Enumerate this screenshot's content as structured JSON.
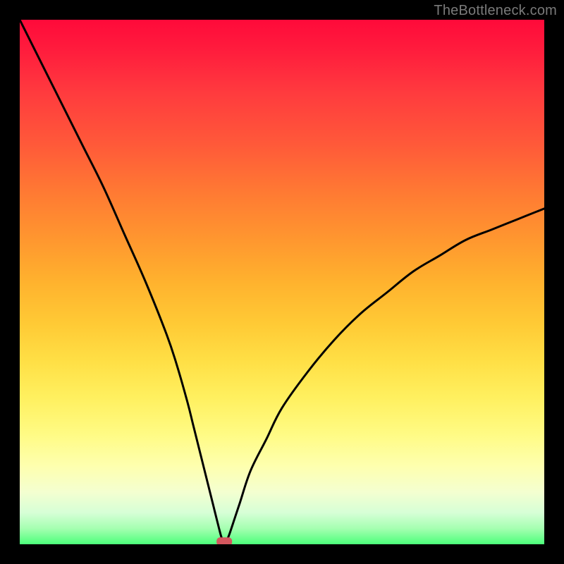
{
  "watermark": "TheBottleneck.com",
  "colors": {
    "frame": "#000000",
    "watermark_text": "#7a7a7a",
    "marker": "#d4575e",
    "gradient_top": "#ff0a3a",
    "gradient_bottom": "#4cff7a",
    "curve": "#000000"
  },
  "chart_data": {
    "type": "line",
    "title": "",
    "xlabel": "",
    "ylabel": "",
    "xlim": [
      0,
      100
    ],
    "ylim": [
      0,
      100
    ],
    "grid": false,
    "legend": false,
    "annotations": [
      {
        "type": "marker",
        "x": 39,
        "y": 0.5,
        "shape": "rounded-rect",
        "color": "#d4575e"
      }
    ],
    "background": "vertical-gradient red→orange→yellow→green",
    "series": [
      {
        "name": "bottleneck-curve",
        "color": "#000000",
        "x": [
          0,
          4,
          8,
          12,
          16,
          20,
          24,
          28,
          30,
          32,
          33,
          34,
          35,
          36,
          37,
          38,
          38.5,
          39,
          39.5,
          40,
          41,
          42,
          44,
          47,
          50,
          55,
          60,
          65,
          70,
          75,
          80,
          85,
          90,
          95,
          100
        ],
        "y": [
          100,
          92,
          84,
          76,
          68,
          59,
          50,
          40,
          34,
          27,
          23,
          19,
          15,
          11,
          7,
          3,
          1.2,
          0.3,
          0.8,
          2,
          5,
          8,
          14,
          20,
          26,
          33,
          39,
          44,
          48,
          52,
          55,
          58,
          60,
          62,
          64
        ]
      }
    ],
    "notes": "Values estimated from pixels on a 0–100 normalized plot area; curve reaches minimum near x≈39 where the marker sits, left arm rises to top-left corner, right arm rises toward ~2/3 height at right edge."
  }
}
